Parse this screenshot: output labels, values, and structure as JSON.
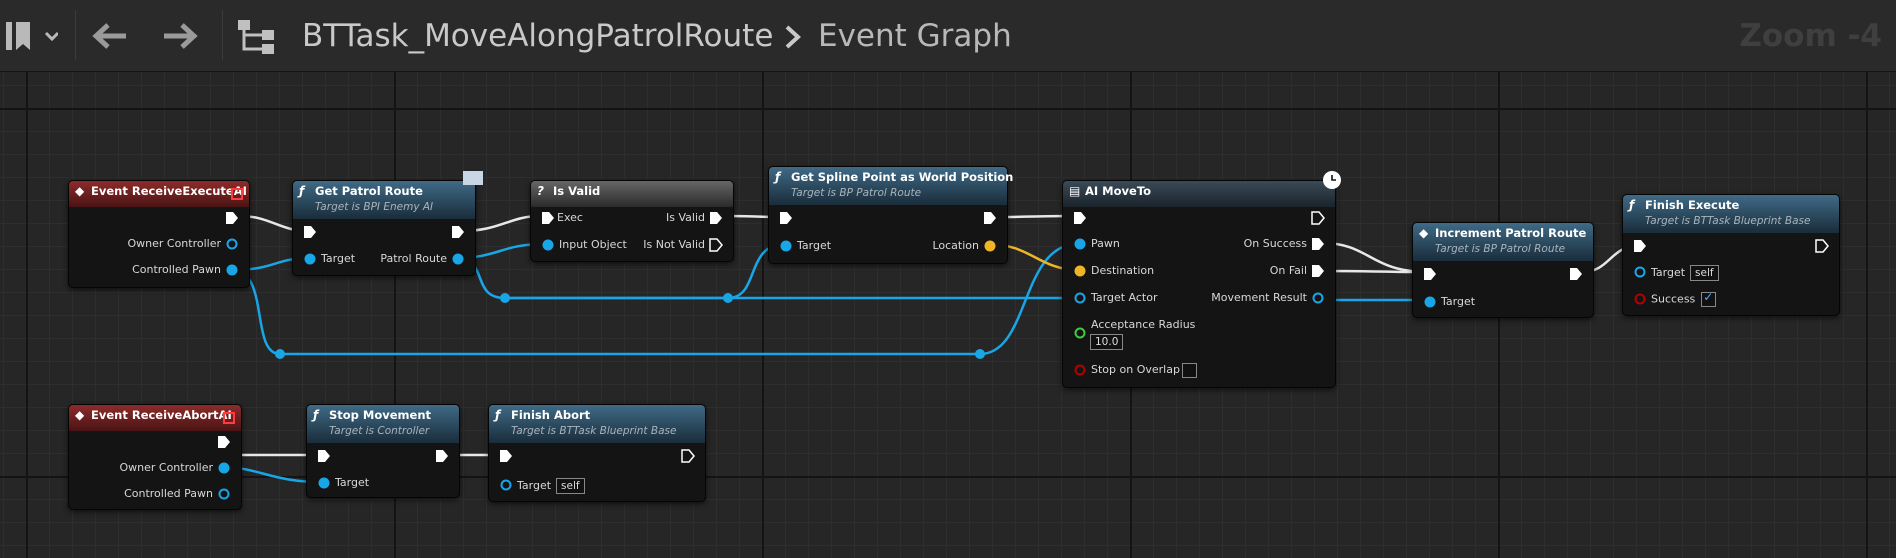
{
  "toolbar": {
    "title": "BTTask_MoveAlongPatrolRoute",
    "separator": ">",
    "subtitle": "Event Graph",
    "zoom": "Zoom -4"
  },
  "nodes": {
    "event_execute": {
      "title": "Event ReceiveExecuteAI",
      "pins": {
        "owner": "Owner Controller",
        "pawn": "Controlled Pawn"
      }
    },
    "get_patrol": {
      "title": "Get Patrol Route",
      "subtitle": "Target is BPI Enemy AI",
      "pins": {
        "target": "Target",
        "out": "Patrol Route"
      }
    },
    "is_valid": {
      "title": "Is Valid",
      "pins": {
        "exec": "Exec",
        "valid": "Is Valid",
        "input": "Input Object",
        "not_valid": "Is Not Valid"
      }
    },
    "get_spline": {
      "title": "Get Spline Point as World Position",
      "subtitle": "Target is BP Patrol Route",
      "pins": {
        "target": "Target",
        "location": "Location"
      }
    },
    "ai_moveto": {
      "title": "AI MoveTo",
      "pins": {
        "pawn": "Pawn",
        "destination": "Destination",
        "target_actor": "Target Actor",
        "radius": "Acceptance Radius",
        "radius_value": "10.0",
        "overlap": "Stop on Overlap",
        "success": "On Success",
        "fail": "On Fail",
        "result": "Movement Result"
      }
    },
    "increment": {
      "title": "Increment Patrol Route",
      "subtitle": "Target is BP Patrol Route",
      "pins": {
        "target": "Target"
      }
    },
    "finish_execute": {
      "title": "Finish Execute",
      "subtitle": "Target is BTTask Blueprint Base",
      "pins": {
        "target": "Target",
        "target_value": "self",
        "success": "Success"
      }
    },
    "event_abort": {
      "title": "Event ReceiveAbortAI",
      "pins": {
        "owner": "Owner Controller",
        "pawn": "Controlled Pawn"
      }
    },
    "stop_movement": {
      "title": "Stop Movement",
      "subtitle": "Target is Controller",
      "pins": {
        "target": "Target"
      }
    },
    "finish_abort": {
      "title": "Finish Abort",
      "subtitle": "Target is BTTask Blueprint Base",
      "pins": {
        "target": "Target",
        "target_value": "self"
      }
    }
  },
  "colors": {
    "object_pin": "#19a6e6",
    "vector_pin": "#f0b526",
    "float_pin": "#3ecb3e",
    "bool_pin": "#b30000",
    "exec": "#ffffff",
    "event_header": "#8d2b2b",
    "function_header": "#406a86",
    "macro_header": "#666666"
  },
  "icons": [
    "bookmark-icon",
    "chevron-down-icon",
    "back-arrow-icon",
    "forward-arrow-icon",
    "hierarchy-icon",
    "function-icon",
    "event-icon",
    "clock-icon",
    "message-icon"
  ]
}
